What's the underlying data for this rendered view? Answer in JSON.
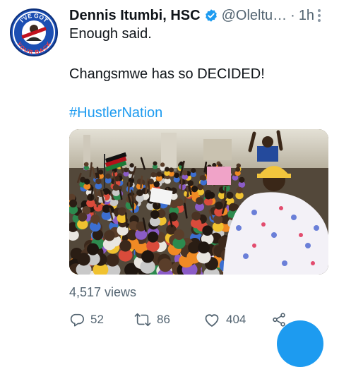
{
  "tweet": {
    "author_name": "Dennis Itumbi, HSC",
    "handle": "@Oleltu…",
    "separator": "·",
    "time": "1h",
    "lines": [
      "Enough said.",
      "Changsmwe has so DECIDED!",
      "#HustlerNation"
    ],
    "avatar_text": {
      "top": "I'VE GOT",
      "bottom": "YOUR BACK"
    },
    "views": "4,517 views",
    "reply_count": "52",
    "retweet_count": "86",
    "like_count": "404"
  },
  "colors": {
    "link": "#1d9bf0",
    "secondary_text": "#536471",
    "verified": "#1d9bf0",
    "avatar_bg": "#1c4fb3"
  },
  "icons": [
    "verified-badge-icon",
    "more-vertical-icon",
    "reply-icon",
    "retweet-icon",
    "like-icon",
    "share-icon"
  ]
}
